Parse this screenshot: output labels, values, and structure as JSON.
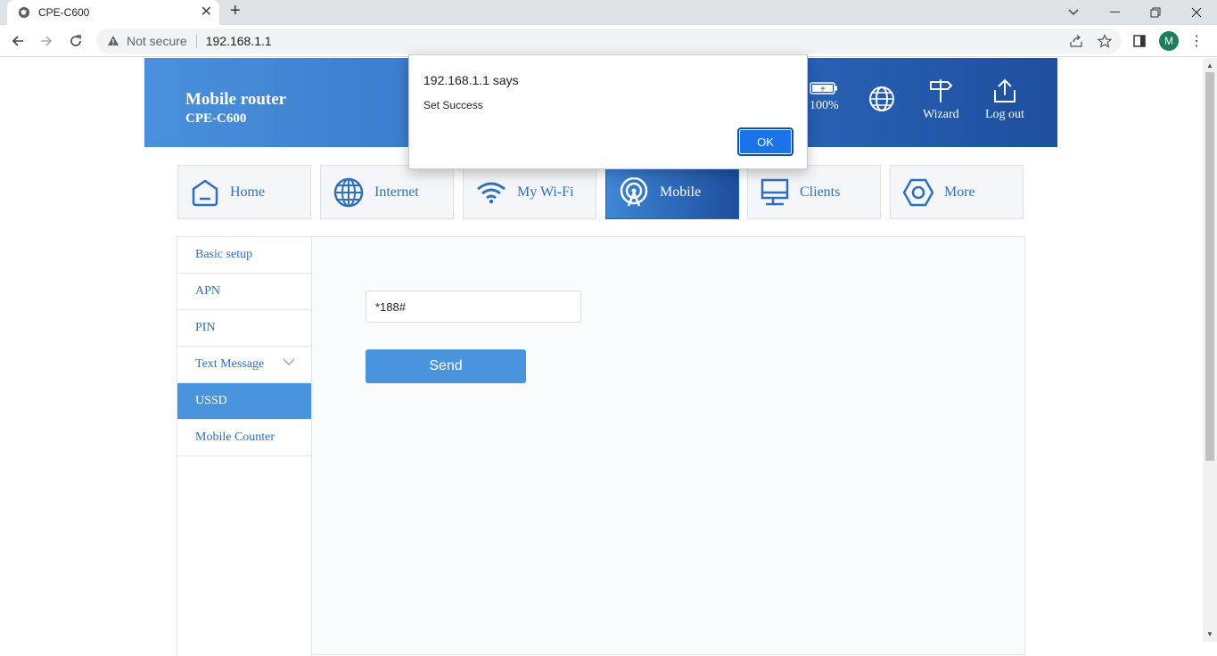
{
  "browser": {
    "tab_title": "CPE-C600",
    "security_label": "Not secure",
    "url": "192.168.1.1",
    "profile_initial": "M"
  },
  "header": {
    "brand_line1": "Mobile router",
    "brand_line2": "CPE-C600",
    "battery": "100%",
    "wizard": "Wizard",
    "logout": "Log out"
  },
  "nav": {
    "tabs": [
      {
        "label": "Home",
        "icon": "home-icon"
      },
      {
        "label": "Internet",
        "icon": "globe-icon"
      },
      {
        "label": "My Wi-Fi",
        "icon": "wifi-icon"
      },
      {
        "label": "Mobile",
        "icon": "signal-icon",
        "active": true
      },
      {
        "label": "Clients",
        "icon": "monitor-icon"
      },
      {
        "label": "More",
        "icon": "hexagon-icon"
      }
    ]
  },
  "sidebar": {
    "items": [
      {
        "label": "Basic setup"
      },
      {
        "label": "APN"
      },
      {
        "label": "PIN"
      },
      {
        "label": "Text Message"
      },
      {
        "label": "USSD",
        "active": true
      },
      {
        "label": "Mobile Counter"
      }
    ]
  },
  "ussd": {
    "value": "*188#",
    "send_label": "Send"
  },
  "dialog": {
    "title": "192.168.1.1 says",
    "message": "Set Success",
    "ok_label": "OK"
  },
  "colors": {
    "accent": "#4a94de",
    "header_dark": "#1f4f9e",
    "text_blue": "#2f6fbf"
  }
}
